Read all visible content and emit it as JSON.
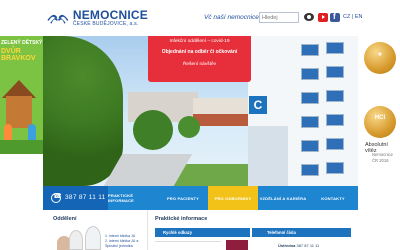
{
  "header": {
    "logo_title": "NEMOCNICE",
    "logo_subtitle": "ČESKÉ BUDĚJOVICE, a.s.",
    "search_label": "Vč naší nemocnice:",
    "search_placeholder": "Hledej",
    "languages": "CZ | EN"
  },
  "left_ad": {
    "line1": "ZELENÝ DĚTSKÝ",
    "line2": "DVŮR BRAVKOV"
  },
  "hero": {
    "notice_lines": [
      "Infekční oddělení – covid-19",
      "Objednání na odběr či očkování",
      "Řešení návštěv"
    ],
    "building_sign": "C"
  },
  "awards": {
    "badge1": "★",
    "badge2": "HCI",
    "title": "Absolutní vítěz",
    "subtitle": "Nemocnice ČR 2016"
  },
  "phone_bar": {
    "number": "387 87 11 11"
  },
  "nav": {
    "items": [
      "Praktické informace",
      "Pro pacienty",
      "Pro odborníky",
      "Vzdělání a kariéra",
      "Kontakty"
    ],
    "active_index": 2
  },
  "bottom": {
    "col1_title": "Oddělení",
    "col1_links": [
      "1. interní klinika JU",
      "2. interní klinika JU a Spinální jednotka"
    ],
    "col2_title": "Praktické informace",
    "tab_left": "Rychlé odkazy",
    "tab_right": "Telefonní čísla",
    "phone_label": "Ústředna",
    "phone_value": "387 87 11 11"
  },
  "colors": {
    "brand_blue": "#1f4e9c",
    "nav_blue": "#1e85d0",
    "notice_red": "#e62f3a",
    "active_yellow": "#f2c218"
  }
}
